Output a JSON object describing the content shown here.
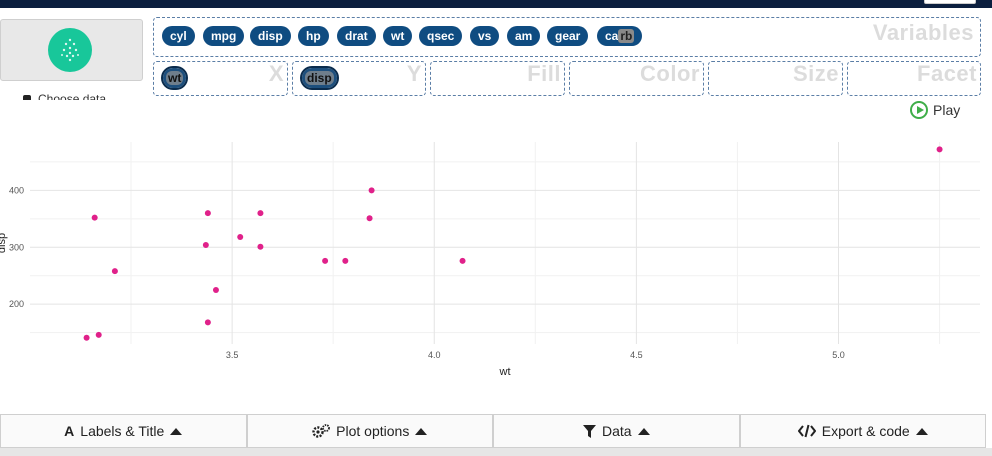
{
  "variables_label": "Variables",
  "variable_pills": [
    "cyl",
    "mpg",
    "disp",
    "hp",
    "drat",
    "wt",
    "qsec",
    "vs",
    "am",
    "gear"
  ],
  "dragging_pill": {
    "prefix": "ca",
    "ghost": "rb"
  },
  "sidebar_hint": "Choose data",
  "mapping": {
    "x": {
      "label": "X",
      "value": "wt"
    },
    "y": {
      "label": "Y",
      "value": "disp"
    },
    "fill": {
      "label": "Fill"
    },
    "color": {
      "label": "Color"
    },
    "size": {
      "label": "Size"
    },
    "facet": {
      "label": "Facet"
    }
  },
  "play_label": "Play",
  "colors": {
    "accent": "#0f4c81",
    "point": "#e0218a",
    "logo": "#18c79a",
    "play": "#3fae49"
  },
  "chart_data": {
    "type": "scatter",
    "xlabel": "wt",
    "ylabel": "disp",
    "xticks": [
      "3.5",
      "4.0",
      "4.5",
      "5.0"
    ],
    "yticks": [
      "200",
      "300",
      "400"
    ],
    "xlim": [
      3.0,
      5.35
    ],
    "ylim": [
      130,
      485
    ],
    "points": [
      {
        "x": 3.14,
        "y": 141
      },
      {
        "x": 3.16,
        "y": 352
      },
      {
        "x": 3.17,
        "y": 146
      },
      {
        "x": 3.21,
        "y": 258
      },
      {
        "x": 3.435,
        "y": 304
      },
      {
        "x": 3.44,
        "y": 360
      },
      {
        "x": 3.44,
        "y": 168
      },
      {
        "x": 3.46,
        "y": 225
      },
      {
        "x": 3.52,
        "y": 318
      },
      {
        "x": 3.57,
        "y": 360
      },
      {
        "x": 3.57,
        "y": 301
      },
      {
        "x": 3.73,
        "y": 276
      },
      {
        "x": 3.78,
        "y": 276
      },
      {
        "x": 3.84,
        "y": 351
      },
      {
        "x": 3.845,
        "y": 400
      },
      {
        "x": 4.07,
        "y": 276
      },
      {
        "x": 5.25,
        "y": 472
      }
    ]
  },
  "footer_tabs": [
    {
      "label": "Labels & Title",
      "icon": "A"
    },
    {
      "label": "Plot options",
      "icon": "gears-icon"
    },
    {
      "label": "Data",
      "icon": "filter-icon"
    },
    {
      "label": "Export & code",
      "icon": "code-icon"
    }
  ]
}
